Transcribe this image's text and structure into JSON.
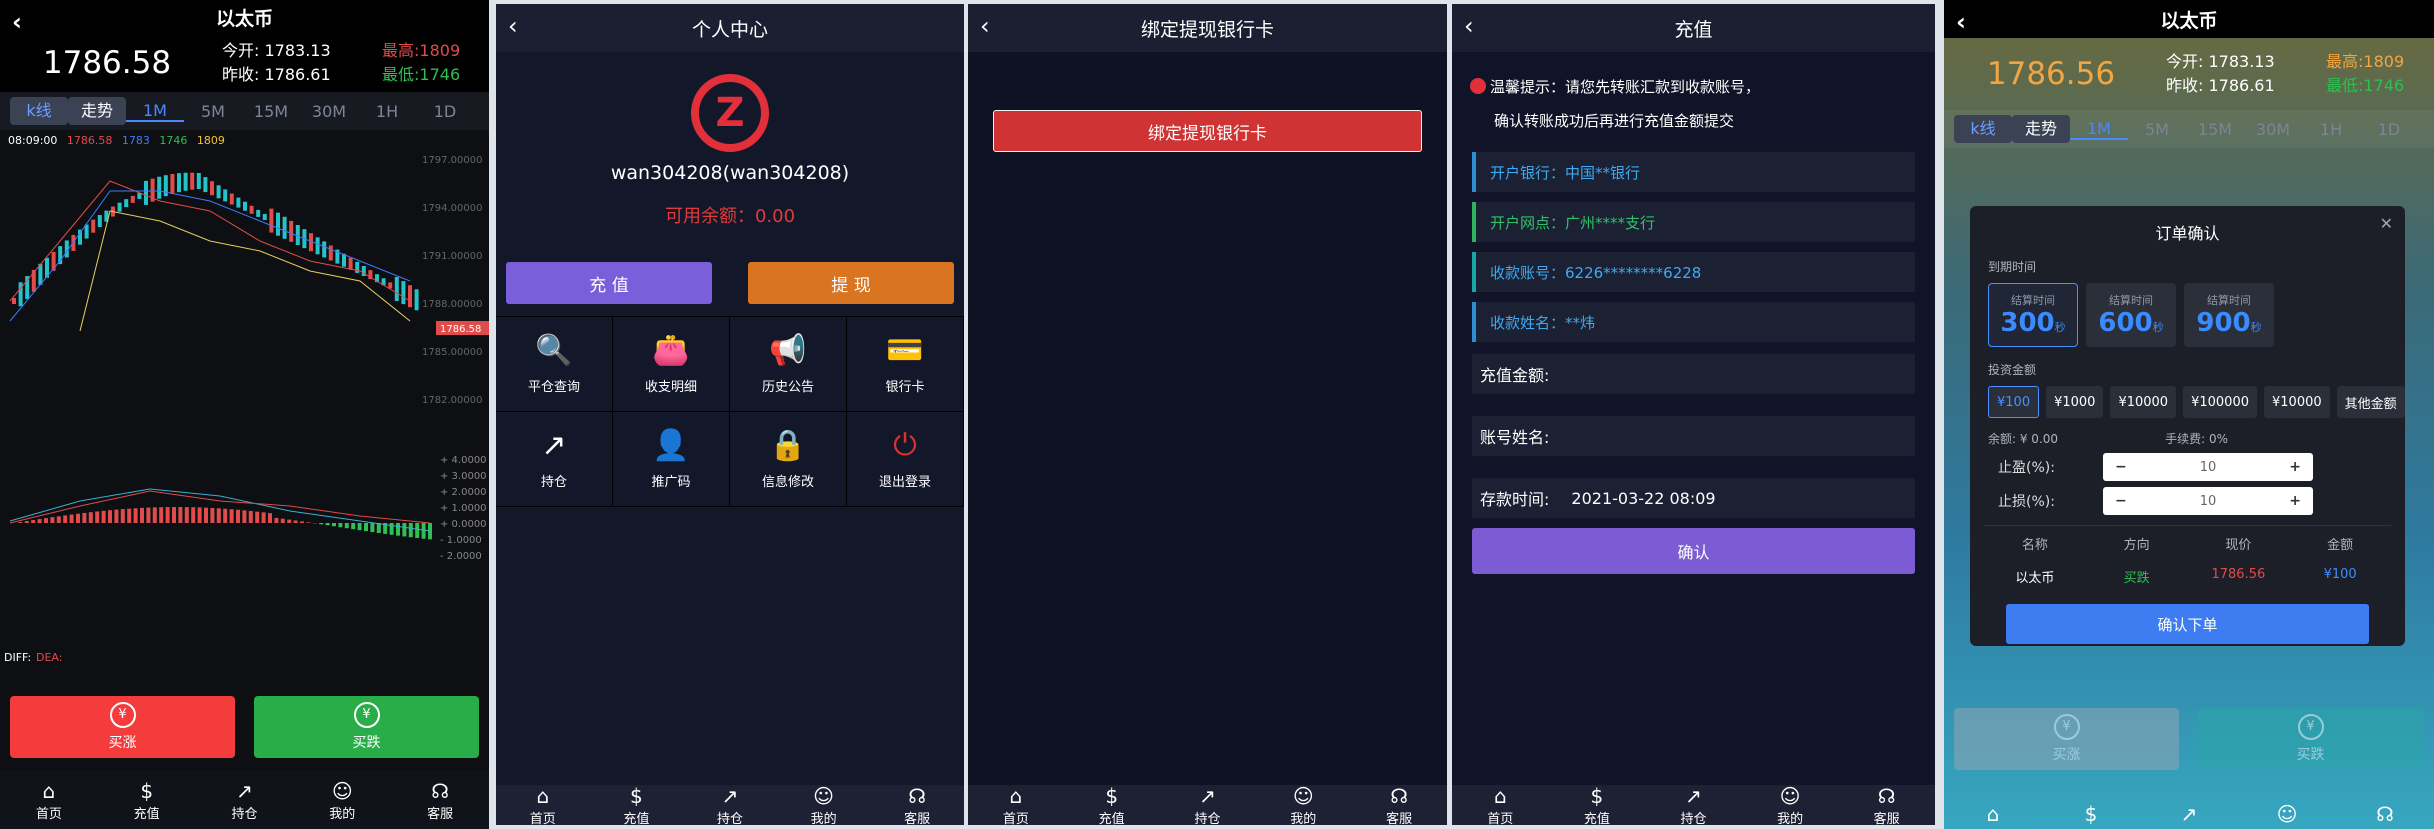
{
  "p1": {
    "title": "以太币",
    "price": "1786.58",
    "open_label": "今开:",
    "open": "1783.13",
    "high_label": "最高:",
    "high": "1809",
    "prev_label": "昨收:",
    "prev": "1786.61",
    "low_label": "最低:",
    "low": "1746",
    "tabs": [
      "k线",
      "走势",
      "1M",
      "5M",
      "15M",
      "30M",
      "1H",
      "1D"
    ],
    "legend": {
      "time": "08:09:00",
      "v1": "1786.58",
      "v2": "1783",
      "v3": "1746",
      "v4": "1809"
    },
    "y_ticks": [
      "1797.00000",
      "1794.00000",
      "1791.00000",
      "1788.00000",
      "1785.00000",
      "1782.00000"
    ],
    "price_tag": "1786.58",
    "macd_ticks": [
      "+ 4.0000",
      "+ 3.0000",
      "+ 2.0000",
      "+ 1.0000",
      "+ 0.0000",
      "- 1.0000",
      "- 2.0000"
    ],
    "diff_label": "DIFF:",
    "dea_label": "DEA:",
    "rise_label": "买涨",
    "fall_label": "买跌",
    "rise_icon": "¥",
    "fall_icon": "¥"
  },
  "tabbar": [
    "首页",
    "充值",
    "持仓",
    "我的",
    "客服"
  ],
  "p2": {
    "title": "个人中心",
    "username": "wan304208(wan304208)",
    "balance": "可用余额：0.00",
    "recharge": "充 值",
    "withdraw": "提 现",
    "grid": [
      {
        "label": "平仓查询",
        "icon": "search-doc-icon",
        "glyph": "🔍",
        "color": "#8a5ad8"
      },
      {
        "label": "收支明细",
        "icon": "wallet-icon",
        "glyph": "👛",
        "color": "#e6a23c"
      },
      {
        "label": "历史公告",
        "icon": "megaphone-icon",
        "glyph": "📢",
        "color": "#f2c230"
      },
      {
        "label": "银行卡",
        "icon": "card-icon",
        "glyph": "💳",
        "color": "#3aa0f0"
      },
      {
        "label": "持仓",
        "icon": "trend-icon",
        "glyph": "↗",
        "color": "#ffffff"
      },
      {
        "label": "推广码",
        "icon": "user-icon",
        "glyph": "👤",
        "color": "#5a6ae8"
      },
      {
        "label": "信息修改",
        "icon": "lock-icon",
        "glyph": "🔒",
        "color": "#f0b030"
      },
      {
        "label": "退出登录",
        "icon": "power-icon",
        "glyph": "⏻",
        "color": "#e03030"
      }
    ]
  },
  "p3": {
    "title": "绑定提现银行卡",
    "button": "绑定提现银行卡"
  },
  "p4": {
    "title": "充值",
    "tip1": "温馨提示：请您先转账汇款到收款账号，",
    "tip2": "确认转账成功后再进行充值金额提交",
    "bank": "开户银行：中国**银行",
    "branch": "开户网点：广州****支行",
    "account": "收款账号：6226********6228",
    "name": "收款姓名：**炜",
    "amount_label": "充值金额:",
    "account_name_label": "账号姓名:",
    "time_label": "存款时间:",
    "time_value": "2021-03-22 08:09",
    "confirm": "确认"
  },
  "p5": {
    "title": "以太币",
    "price": "1786.56",
    "open_label": "今开:",
    "open": "1783.13",
    "high_label": "最高:",
    "high": "1809",
    "prev_label": "昨收:",
    "prev": "1786.61",
    "low_label": "最低:",
    "low": "1746",
    "modal_title": "订单确认",
    "expiry_label": "到期时间",
    "times": [
      {
        "a": "结算时间",
        "b": "300",
        "u": "秒"
      },
      {
        "a": "结算时间",
        "b": "600",
        "u": "秒"
      },
      {
        "a": "结算时间",
        "b": "900",
        "u": "秒"
      }
    ],
    "invest_label": "投资金额",
    "amounts": [
      "¥100",
      "¥1000",
      "¥10000",
      "¥100000",
      "¥10000",
      "其他金额"
    ],
    "balance": "余额: ¥ 0.00",
    "fee": "手续费: 0%",
    "tp_label": "止盈(%):",
    "tp_value": "10",
    "sl_label": "止损(%):",
    "sl_value": "10",
    "cols": [
      "名称",
      "方向",
      "现价",
      "金额"
    ],
    "row": [
      "以太币",
      "买跌",
      "1786.56",
      "¥100"
    ],
    "submit": "确认下单",
    "rise_label": "买涨",
    "fall_label": "买跌"
  },
  "colors": {
    "red": "#f43c3c",
    "green": "#28ad48",
    "purple": "#7b5ed9",
    "blue": "#3e7cf2"
  }
}
